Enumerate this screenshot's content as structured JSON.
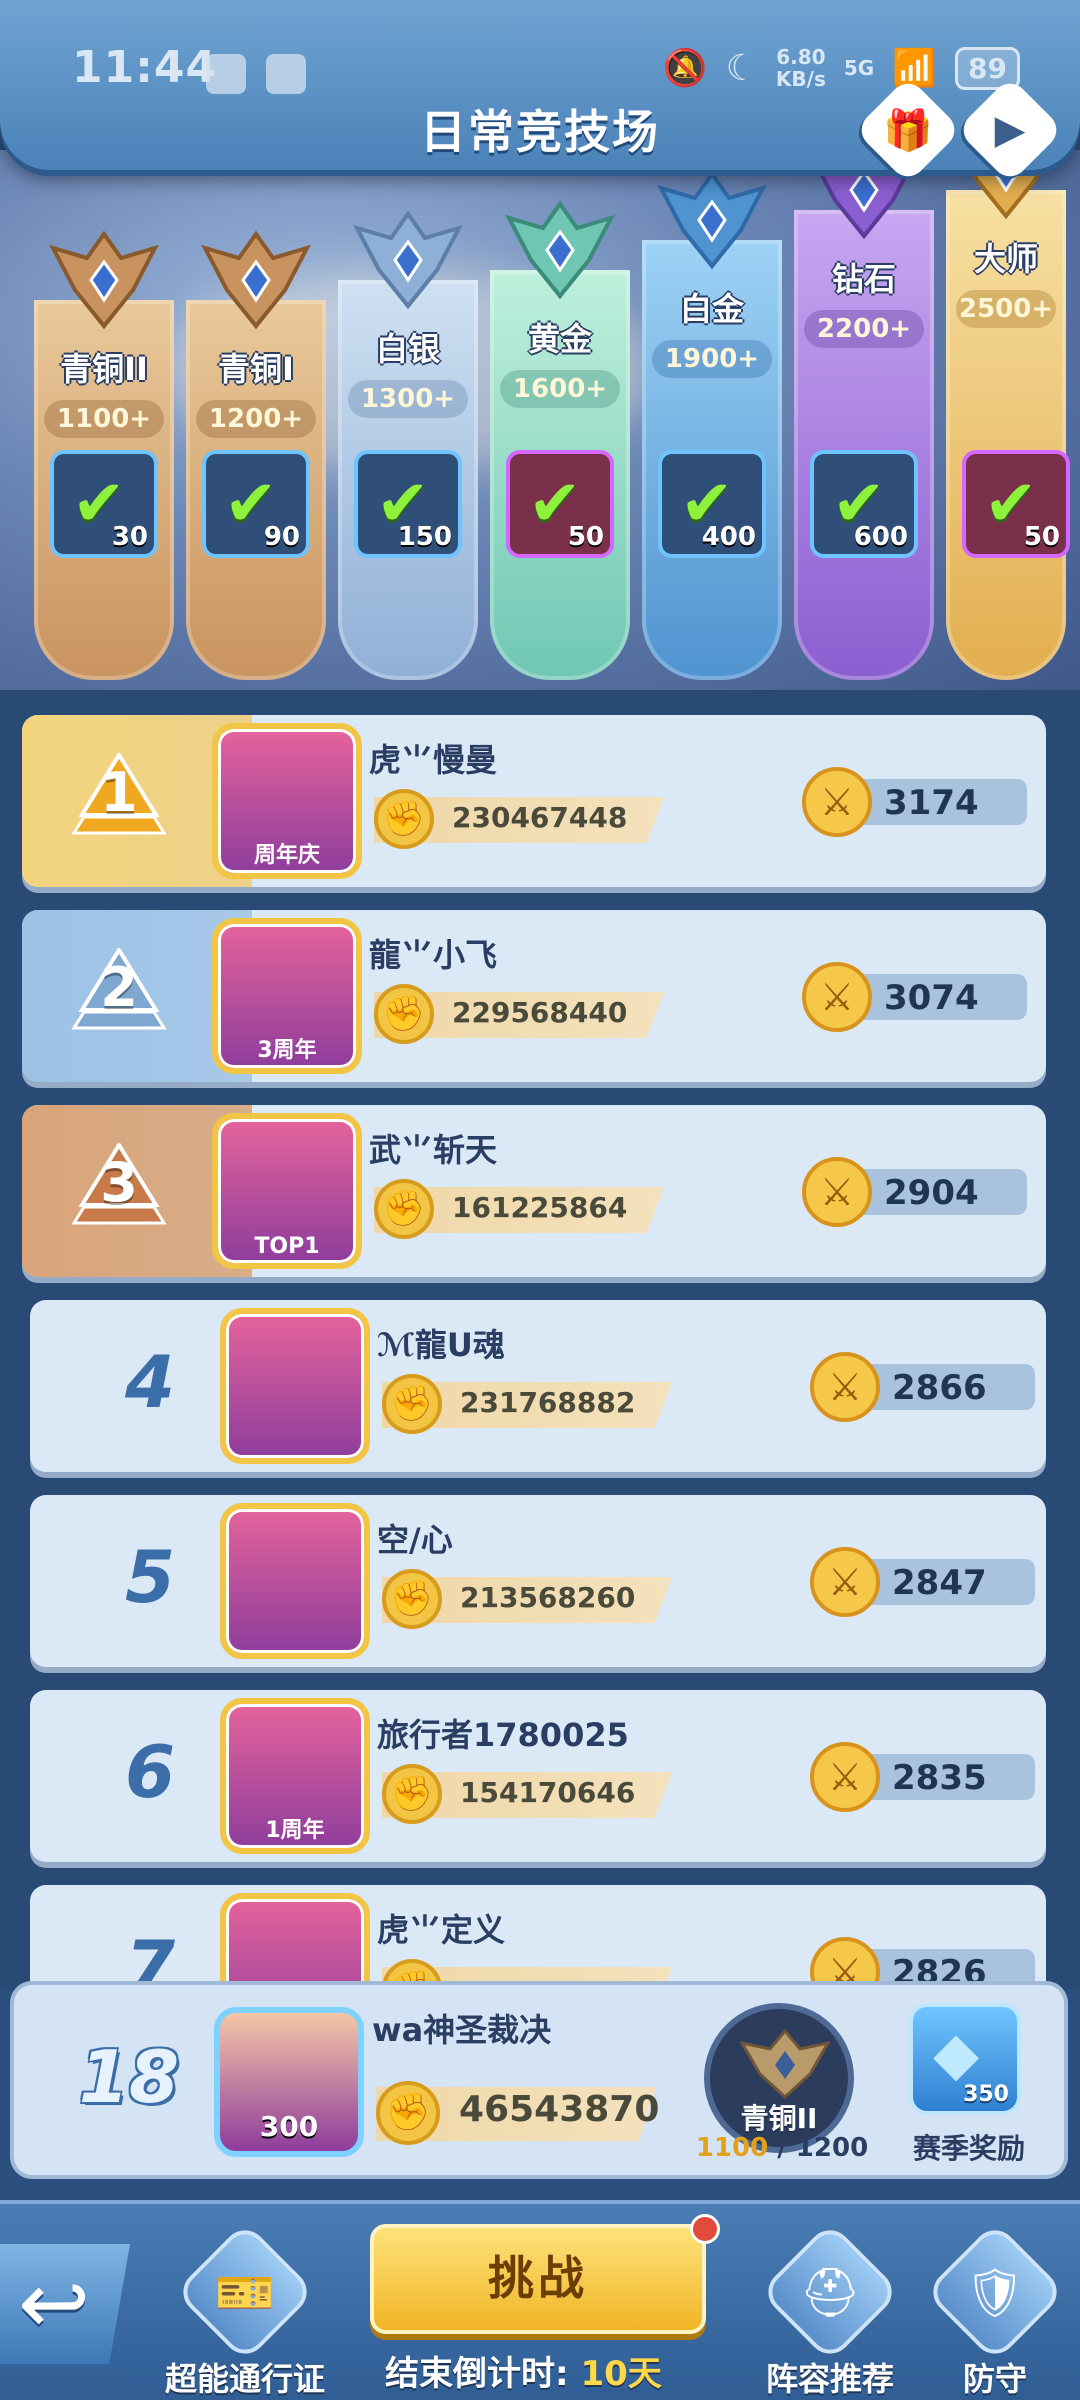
{
  "status_bar": {
    "time": "11:44",
    "net_speed_value": "6.80",
    "net_speed_unit": "KB/s",
    "network": "5G",
    "battery": "89"
  },
  "header": {
    "title": "日常竞技场",
    "gift_icon": "gift-icon",
    "video_icon": "video-icon"
  },
  "tiers": [
    {
      "name": "青铜II",
      "score": "1100+",
      "reward_count": "30",
      "style": "bronze",
      "reward_style": "blue"
    },
    {
      "name": "青铜I",
      "score": "1200+",
      "reward_count": "90",
      "style": "bronze",
      "reward_style": "blue"
    },
    {
      "name": "白银",
      "score": "1300+",
      "reward_count": "150",
      "style": "silver",
      "reward_style": "blue"
    },
    {
      "name": "黄金",
      "score": "1600+",
      "reward_count": "50",
      "style": "gold",
      "reward_style": "purple"
    },
    {
      "name": "白金",
      "score": "1900+",
      "reward_count": "400",
      "style": "platinum",
      "reward_style": "blue"
    },
    {
      "name": "钻石",
      "score": "2200+",
      "reward_count": "600",
      "style": "diamond",
      "reward_style": "blue"
    },
    {
      "name": "大师",
      "score": "2500+",
      "reward_count": "50",
      "style": "master",
      "reward_style": "purple"
    }
  ],
  "rankings": [
    {
      "rank": "1",
      "name": "虎⺌慢曼",
      "power": "230467448",
      "score": "3174",
      "avatar_tag": "周年庆"
    },
    {
      "rank": "2",
      "name": "龍⺌小飞",
      "power": "229568440",
      "score": "3074",
      "avatar_tag": "3周年"
    },
    {
      "rank": "3",
      "name": "武⺌斩天",
      "power": "161225864",
      "score": "2904",
      "avatar_tag": "TOP1"
    },
    {
      "rank": "4",
      "name": "ℳ龍ᑌ魂",
      "power": "231768882",
      "score": "2866",
      "avatar_tag": ""
    },
    {
      "rank": "5",
      "name": "空/心",
      "power": "213568260",
      "score": "2847",
      "avatar_tag": ""
    },
    {
      "rank": "6",
      "name": "旅行者1780025",
      "power": "154170646",
      "score": "2835",
      "avatar_tag": "1周年"
    },
    {
      "rank": "7",
      "name": "虎⺌定义",
      "power": "",
      "score": "2826",
      "avatar_tag": ""
    }
  ],
  "my_entry": {
    "rank": "18",
    "name": "wa神圣裁决",
    "power": "46543870",
    "avatar_tag": "300",
    "tier_name": "青铜II",
    "tier_current": "1100",
    "tier_sep": " / ",
    "tier_next": "1200",
    "season_reward_label": "赛季奖励",
    "season_reward_count": "350"
  },
  "bottom_nav": {
    "back_icon": "back-arrow-icon",
    "pass_label": "超能通行证",
    "challenge_label": "挑战",
    "countdown_prefix": "结束倒计时:",
    "countdown_value": "10天",
    "lineup_label": "阵容推荐",
    "defense_label": "防守"
  },
  "colors": {
    "gold_row": "#f2d27a",
    "silver_row": "#8fb6dc",
    "bronze_row": "#d49a6a",
    "accent": "#f1b526"
  }
}
